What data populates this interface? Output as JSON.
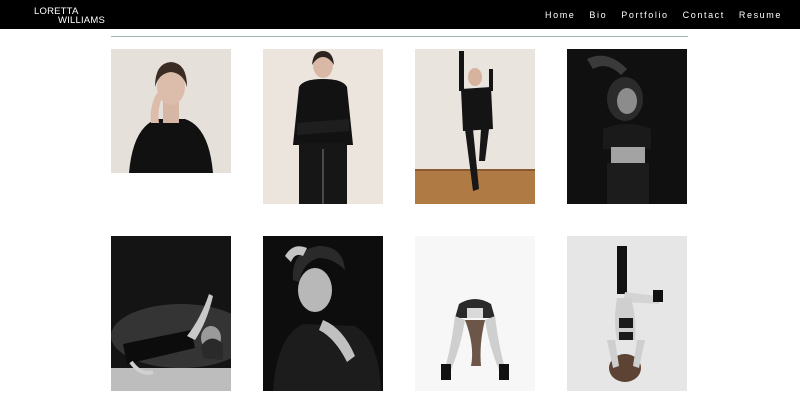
{
  "brand": {
    "line1": "LORETTA",
    "line2": "WILLIAMS"
  },
  "nav": [
    {
      "label": "Home"
    },
    {
      "label": "Bio"
    },
    {
      "label": "Portfolio"
    },
    {
      "label": "Contact"
    },
    {
      "label": "Resume"
    }
  ],
  "colors": {
    "header_bg": "#000000",
    "page_bg": "#ffffff",
    "divider": "#9db7b0"
  },
  "gallery": [
    {
      "subject": "woman in black turtleneck, hand at chin",
      "tone": "color, warm beige backdrop"
    },
    {
      "subject": "woman in black outfit, arms crossed",
      "tone": "color, cream backdrop"
    },
    {
      "subject": "woman posing against wall, one leg raised",
      "tone": "color, wooden floor"
    },
    {
      "subject": "woman with arm over head, black crop top",
      "tone": "black and white, dark backdrop"
    },
    {
      "subject": "woman reclining, arm raised, spotlight",
      "tone": "black and white, dark backdrop"
    },
    {
      "subject": "woman with hand in hair, black blazer",
      "tone": "black and white, dark backdrop"
    },
    {
      "subject": "woman bent forward, hair down, boots",
      "tone": "black and white, white backdrop"
    },
    {
      "subject": "woman in headstand, legs crossed",
      "tone": "black and white, light grey backdrop"
    }
  ]
}
